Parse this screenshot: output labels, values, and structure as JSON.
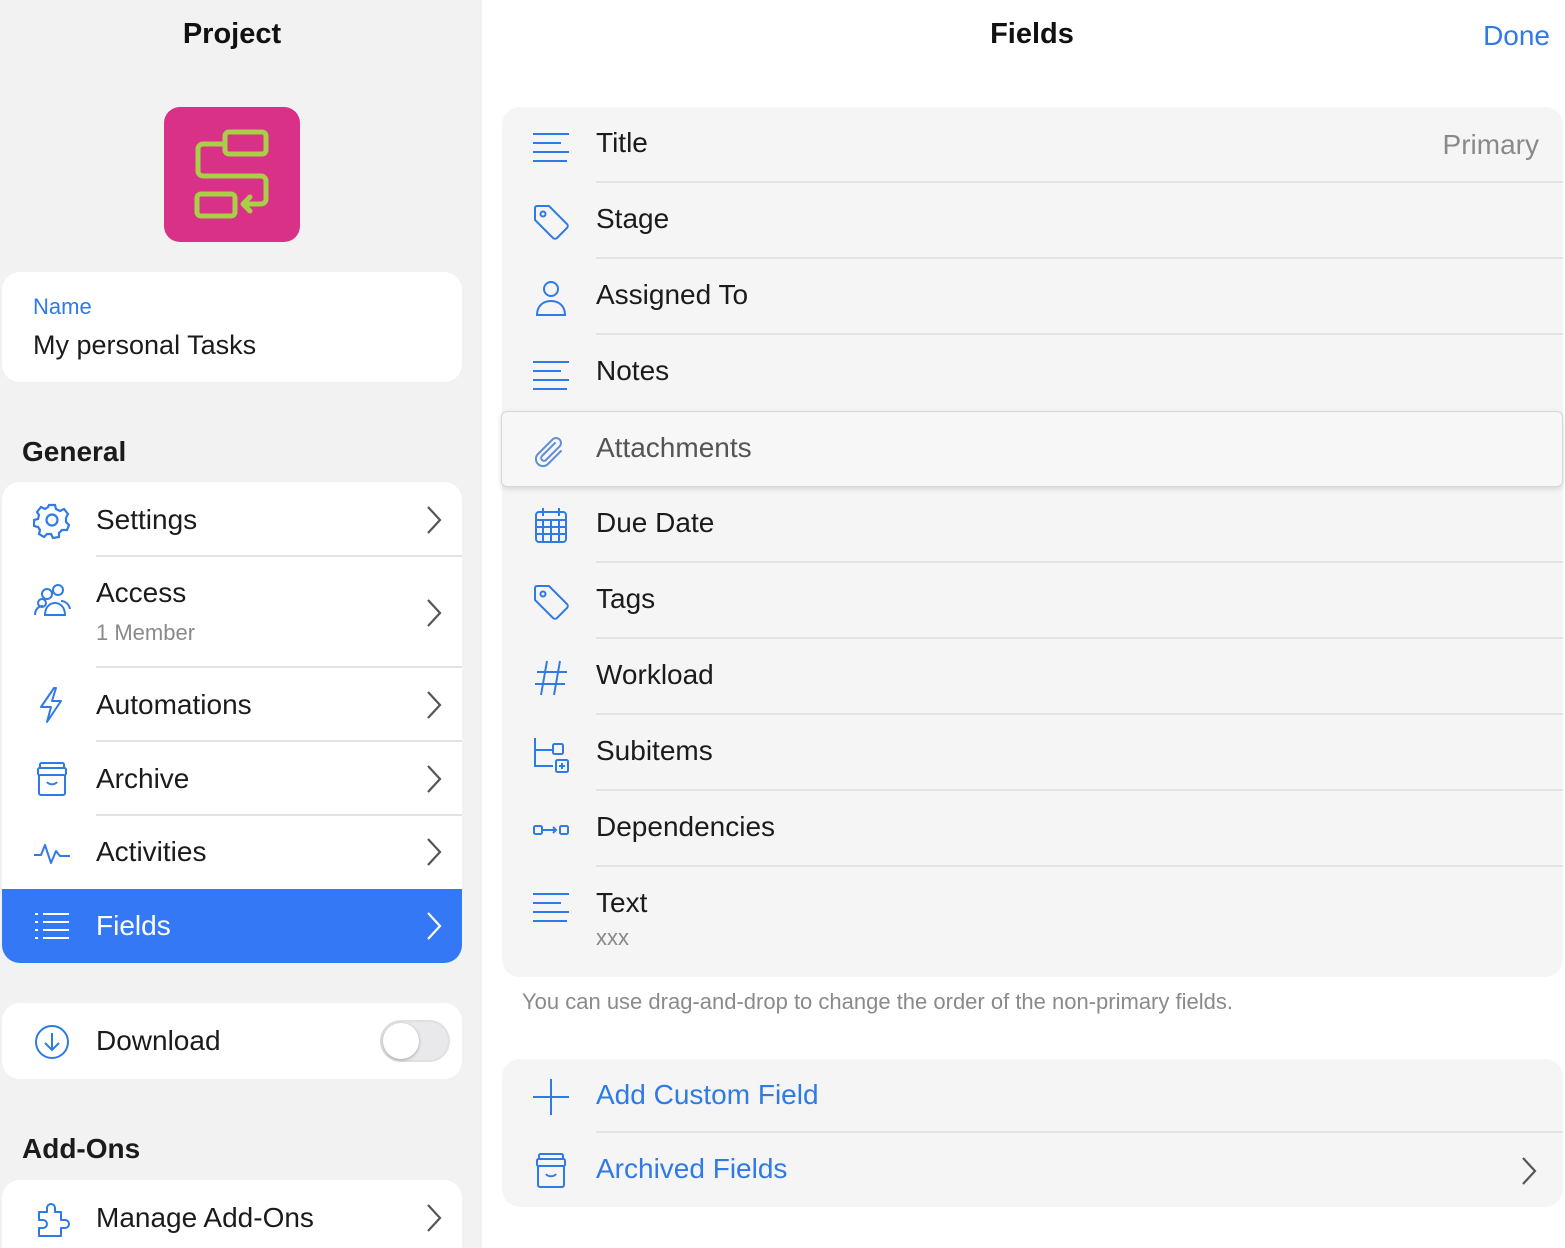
{
  "left_panel": {
    "title": "Project",
    "name_card": {
      "label": "Name",
      "value": "My personal Tasks"
    },
    "general_heading": "General",
    "general_items": [
      {
        "label": "Settings",
        "icon": "gear-icon"
      },
      {
        "label": "Access",
        "sub": "1 Member",
        "icon": "people-icon"
      },
      {
        "label": "Automations",
        "icon": "lightning-icon"
      },
      {
        "label": "Archive",
        "icon": "archive-box-icon"
      },
      {
        "label": "Activities",
        "icon": "activity-pulse-icon"
      },
      {
        "label": "Fields",
        "icon": "list-icon",
        "selected": true
      }
    ],
    "download": {
      "label": "Download",
      "icon": "download-circle-icon",
      "enabled": false
    },
    "addons_heading": "Add-Ons",
    "addons_items": [
      {
        "label": "Manage Add-Ons",
        "icon": "puzzle-icon"
      }
    ]
  },
  "right_panel": {
    "title": "Fields",
    "done_label": "Done",
    "fields": [
      {
        "label": "Title",
        "meta": "Primary",
        "icon": "text-lines-icon"
      },
      {
        "label": "Stage",
        "icon": "tag-icon"
      },
      {
        "label": "Assigned To",
        "icon": "person-icon"
      },
      {
        "label": "Notes",
        "icon": "text-lines-icon"
      },
      {
        "label": "Attachments",
        "icon": "paperclip-icon",
        "dragging": true
      },
      {
        "label": "Due Date",
        "icon": "calendar-icon"
      },
      {
        "label": "Tags",
        "icon": "tag-icon"
      },
      {
        "label": "Workload",
        "icon": "hash-icon"
      },
      {
        "label": "Subitems",
        "icon": "subitems-icon"
      },
      {
        "label": "Dependencies",
        "icon": "dependencies-icon"
      },
      {
        "label": "Text",
        "sub": "xxx",
        "icon": "text-lines-icon"
      }
    ],
    "footnote": "You can use drag-and-drop to change the order of the non-primary fields.",
    "actions": [
      {
        "label": "Add Custom Field",
        "icon": "plus-icon"
      },
      {
        "label": "Archived Fields",
        "icon": "archive-box-icon"
      }
    ]
  },
  "colors": {
    "accent": "#2f7ae5",
    "selected_row": "#3478f6",
    "app_icon_bg": "#d93088",
    "app_icon_fg": "#a8cf45"
  }
}
